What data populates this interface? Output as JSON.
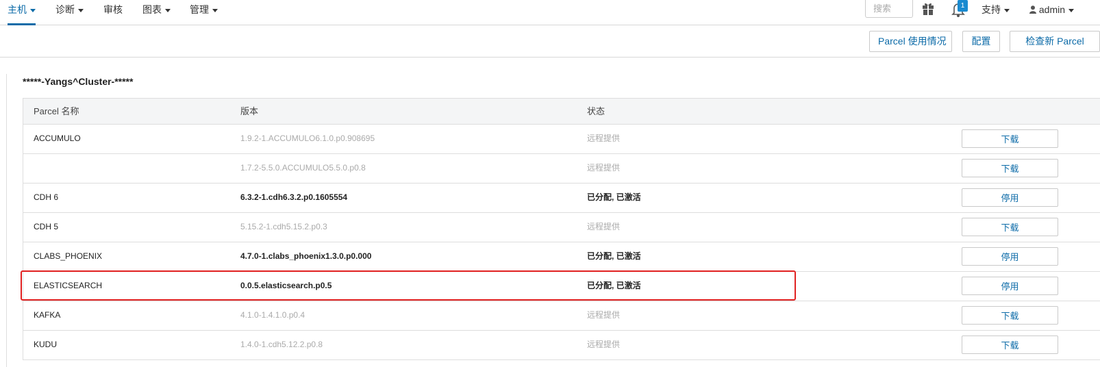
{
  "nav": {
    "items": [
      {
        "label": "主机",
        "dropdown": true,
        "active": true
      },
      {
        "label": "诊断",
        "dropdown": true,
        "active": false
      },
      {
        "label": "审核",
        "dropdown": false,
        "active": false
      },
      {
        "label": "图表",
        "dropdown": true,
        "active": false
      },
      {
        "label": "管理",
        "dropdown": true,
        "active": false
      }
    ],
    "search_placeholder": "搜索",
    "gift_icon": "gift-icon",
    "bell_icon": "bell-icon",
    "notification_count": "1",
    "support_label": "支持",
    "user_label": "admin",
    "user_icon": "user-icon"
  },
  "toolbar": {
    "parcel_usage_label": "Parcel 使用情况",
    "config_label": "配置",
    "check_new_label": "检查新 Parcel"
  },
  "cluster": {
    "title": "*****-Yangs^Cluster-*****"
  },
  "table": {
    "headers": {
      "name": "Parcel 名称",
      "version": "版本",
      "status": "状态"
    },
    "rows": [
      {
        "name": "ACCUMULO",
        "version": "1.9.2-1.ACCUMULO6.1.0.p0.908695",
        "status": "远程提供",
        "action": "下载",
        "active": false
      },
      {
        "name": "",
        "version": "1.7.2-5.5.0.ACCUMULO5.5.0.p0.8",
        "status": "远程提供",
        "action": "下载",
        "active": false
      },
      {
        "name": "CDH 6",
        "version": "6.3.2-1.cdh6.3.2.p0.1605554",
        "status": "已分配, 已激活",
        "action": "停用",
        "active": true
      },
      {
        "name": "CDH 5",
        "version": "5.15.2-1.cdh5.15.2.p0.3",
        "status": "远程提供",
        "action": "下载",
        "active": false
      },
      {
        "name": "CLABS_PHOENIX",
        "version": "4.7.0-1.clabs_phoenix1.3.0.p0.000",
        "status": "已分配, 已激活",
        "action": "停用",
        "active": true
      },
      {
        "name": "ELASTICSEARCH",
        "version": "0.0.5.elasticsearch.p0.5",
        "status": "已分配, 已激活",
        "action": "停用",
        "active": true
      },
      {
        "name": "KAFKA",
        "version": "4.1.0-1.4.1.0.p0.4",
        "status": "远程提供",
        "action": "下载",
        "active": false
      },
      {
        "name": "KUDU",
        "version": "1.4.0-1.cdh5.12.2.p0.8",
        "status": "远程提供",
        "action": "下载",
        "active": false
      }
    ]
  },
  "colors": {
    "accent": "#0c6ba8",
    "highlight_border": "#e02020",
    "badge": "#1a8bd0"
  }
}
